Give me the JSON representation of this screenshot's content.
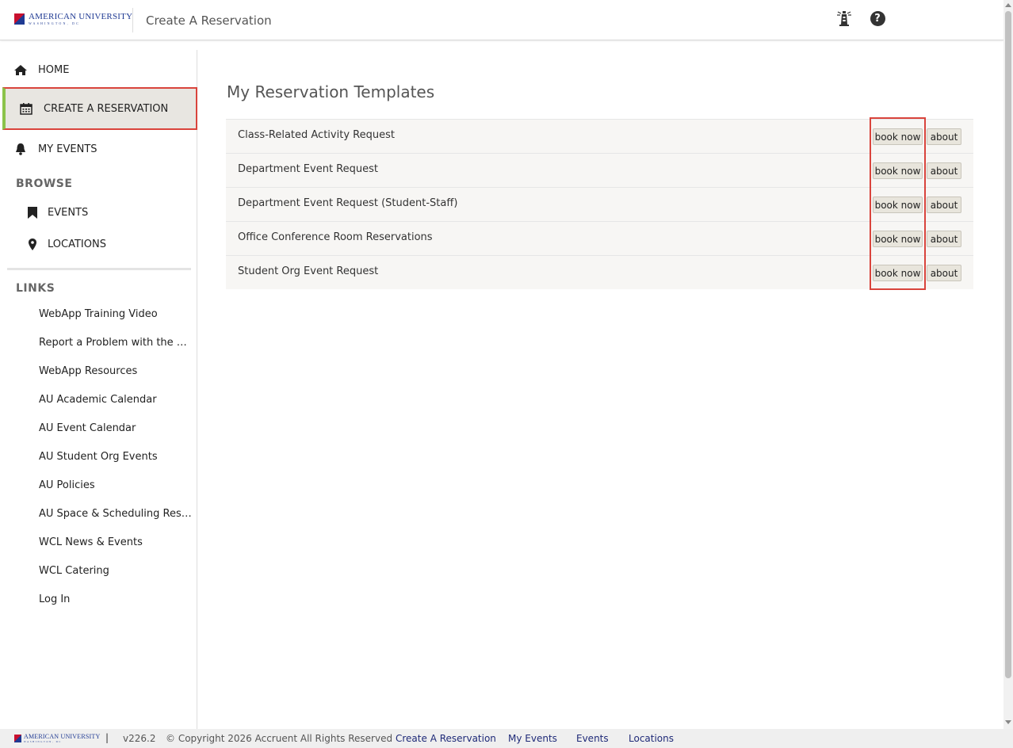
{
  "header": {
    "logo_name": "AMERICAN UNIVERSITY",
    "logo_sub": "WASHINGTON, DC",
    "title": "Create A Reservation",
    "icons": [
      "lighthouse-icon",
      "help-icon"
    ]
  },
  "sidebar": {
    "nav": [
      {
        "label": "HOME",
        "icon": "home-icon"
      },
      {
        "label": "CREATE A RESERVATION",
        "icon": "calendar-icon",
        "active": true
      },
      {
        "label": "MY EVENTS",
        "icon": "bell-icon"
      }
    ],
    "browse_label": "BROWSE",
    "browse": [
      {
        "label": "EVENTS",
        "icon": "bookmark-icon"
      },
      {
        "label": "LOCATIONS",
        "icon": "map-pin-icon"
      }
    ],
    "links_label": "LINKS",
    "links": [
      "WebApp Training Video",
      "Report a Problem with the WebApp",
      "WebApp Resources",
      "AU Academic Calendar",
      "AU Event Calendar",
      "AU Student Org Events",
      "AU Policies",
      "AU Space & Scheduling Resources",
      "WCL News & Events",
      "WCL Catering",
      "Log In"
    ]
  },
  "main": {
    "title": "My Reservation Templates",
    "book_label": "book now",
    "about_label": "about",
    "templates": [
      "Class-Related Activity Request",
      "Department Event Request",
      "Department Event Request (Student-Staff)",
      "Office Conference Room Reservations",
      "Student Org Event Request"
    ]
  },
  "footer": {
    "logo_name": "AMERICAN UNIVERSITY",
    "logo_sub": "WASHINGTON, DC",
    "pipe": "|",
    "version": "v226.2",
    "copyright": "© Copyright 2026 Accruent All Rights Reserved",
    "links": [
      "Create A Reservation",
      "My Events",
      "Events",
      "Locations"
    ]
  },
  "colors": {
    "highlight": "#d9443c",
    "active_bg": "#e8e6e1",
    "footer_link": "#1f2a78"
  }
}
